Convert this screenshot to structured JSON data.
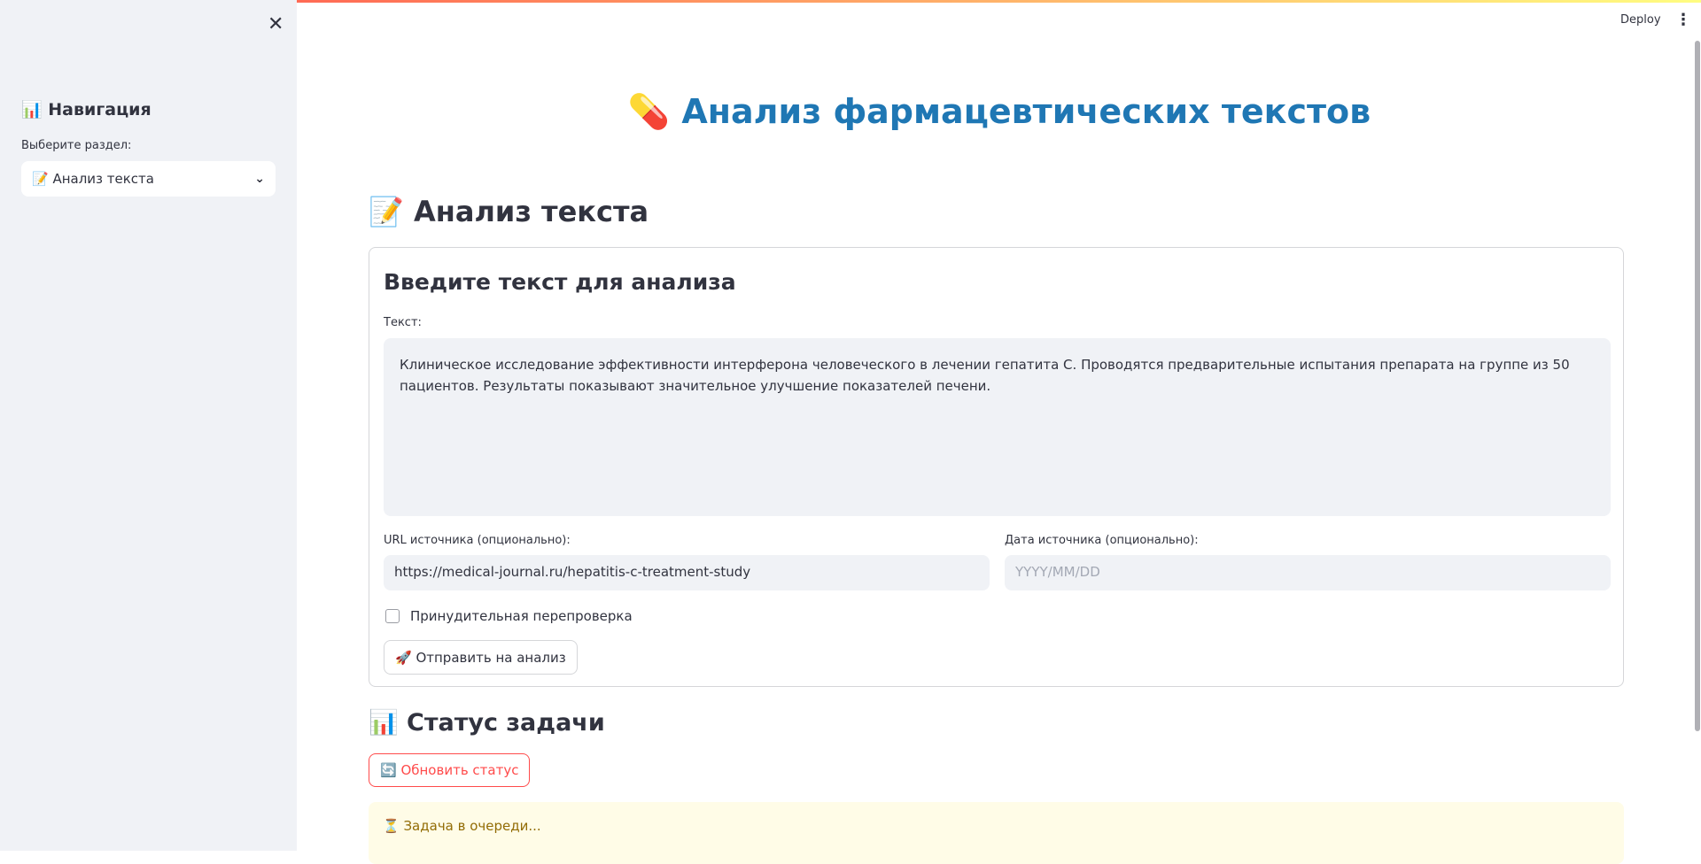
{
  "header": {
    "deploy_label": "Deploy",
    "menu_icon": "⋮"
  },
  "sidebar": {
    "close_icon": "✕",
    "heading": "📊 Навигация",
    "select_label": "Выберите раздел:",
    "select_value": "📝 Анализ текста",
    "chevron": "⌄"
  },
  "main": {
    "title": "💊 Анализ фармацевтических текстов",
    "section_title": "📝 Анализ текста",
    "form": {
      "heading": "Введите текст для анализа",
      "text_label": "Текст:",
      "text_value": "Клиническое исследование эффективности интерферона человеческого в лечении гепатита С. Проводятся предварительные испытания препарата на группе из 50 пациентов. Результаты показывают значительное улучшение показателей печени.",
      "url_label": "URL источника (опционально):",
      "url_value": "https://medical-journal.ru/hepatitis-c-treatment-study",
      "date_label": "Дата источника (опционально):",
      "date_placeholder": "YYYY/MM/DD",
      "checkbox_label": "Принудительная перепроверка",
      "checkbox_checked": false,
      "submit_label": "🚀 Отправить на анализ"
    },
    "status": {
      "title": "📊 Статус задачи",
      "refresh_label": "🔄 Обновить статус",
      "alert_text": "⏳ Задача в очереди..."
    }
  },
  "colors": {
    "accent": "#ff4b4b",
    "title": "#1f77b4",
    "warning_bg": "#fffce7",
    "warning_text": "#926c05"
  }
}
